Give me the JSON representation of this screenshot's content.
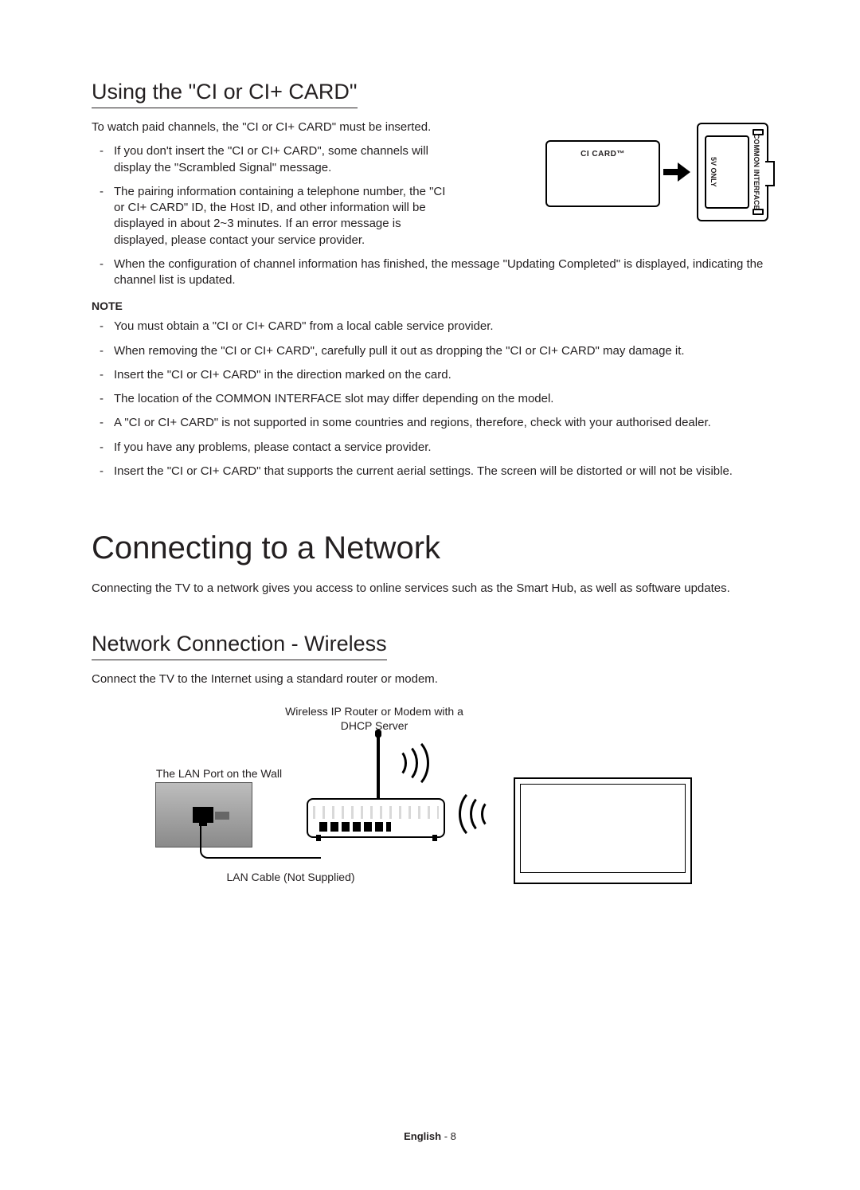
{
  "section1": {
    "title": "Using the \"CI or CI+ CARD\"",
    "intro": "To watch paid channels, the \"CI or CI+ CARD\" must be inserted.",
    "bullets_top": [
      "If you don't insert the \"CI or CI+ CARD\", some channels will display the \"Scrambled Signal\" message.",
      "The pairing information containing a telephone number, the \"CI or CI+ CARD\" ID, the Host ID, and other information will be displayed in about 2~3 minutes. If an error message is displayed, please contact your service provider."
    ],
    "bullets_mid": [
      "When the configuration of channel information has finished, the message \"Updating Completed\" is displayed, indicating the channel list is updated."
    ],
    "note_label": "NOTE",
    "note_bullets": [
      "You must obtain a \"CI or CI+ CARD\" from a local cable service provider.",
      "When removing the \"CI or CI+ CARD\", carefully pull it out as dropping the \"CI or CI+ CARD\" may damage it.",
      "Insert the \"CI or CI+ CARD\" in the direction marked on the card.",
      "The location of the COMMON INTERFACE slot may differ depending on the model.",
      "A \"CI or CI+ CARD\" is not supported in some countries and regions, therefore, check with your authorised dealer.",
      "If you have any problems, please contact a service provider.",
      "Insert the \"CI or CI+ CARD\" that supports the current aerial settings. The screen will be distorted or will not be visible."
    ],
    "diagram": {
      "card_label": "CI CARD™",
      "slot_label_right": "COMMON INTERFACE",
      "slot_label_left": "5V ONLY"
    }
  },
  "section2": {
    "heading": "Connecting to a Network",
    "intro": "Connecting the TV to a network gives you access to online services such as the Smart Hub, as well as software updates.",
    "sub_title": "Network Connection - Wireless",
    "sub_intro": "Connect the TV to the Internet using a standard router or modem.",
    "diagram": {
      "router_caption": "Wireless IP Router or Modem with a DHCP Server",
      "wall_caption": "The LAN Port on the Wall",
      "cable_caption": "LAN Cable (Not Supplied)"
    }
  },
  "footer": {
    "language": "English",
    "sep": " - ",
    "page": "8"
  }
}
